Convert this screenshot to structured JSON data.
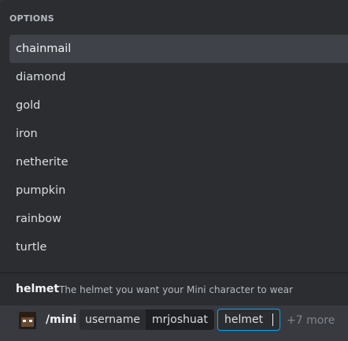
{
  "options_popup": {
    "header": "OPTIONS",
    "items": [
      {
        "label": "chainmail",
        "selected": true
      },
      {
        "label": "diamond",
        "selected": false
      },
      {
        "label": "gold",
        "selected": false
      },
      {
        "label": "iron",
        "selected": false
      },
      {
        "label": "netherite",
        "selected": false
      },
      {
        "label": "pumpkin",
        "selected": false
      },
      {
        "label": "rainbow",
        "selected": false
      },
      {
        "label": "turtle",
        "selected": false
      }
    ]
  },
  "param_info": {
    "name": "helmet",
    "description": "The helmet you want your Mini character to wear"
  },
  "command_bar": {
    "avatar_icon": "minecraft-skin-avatar",
    "command": "/mini",
    "args": [
      {
        "key": "username",
        "value": "mrjoshuat"
      }
    ],
    "active_arg": "helmet",
    "more_label": "+7 more"
  },
  "colors": {
    "selected_bg": "#404249",
    "active_border": "#00a8fc",
    "popup_bg": "#2b2d31",
    "input_bg": "#383a40"
  }
}
